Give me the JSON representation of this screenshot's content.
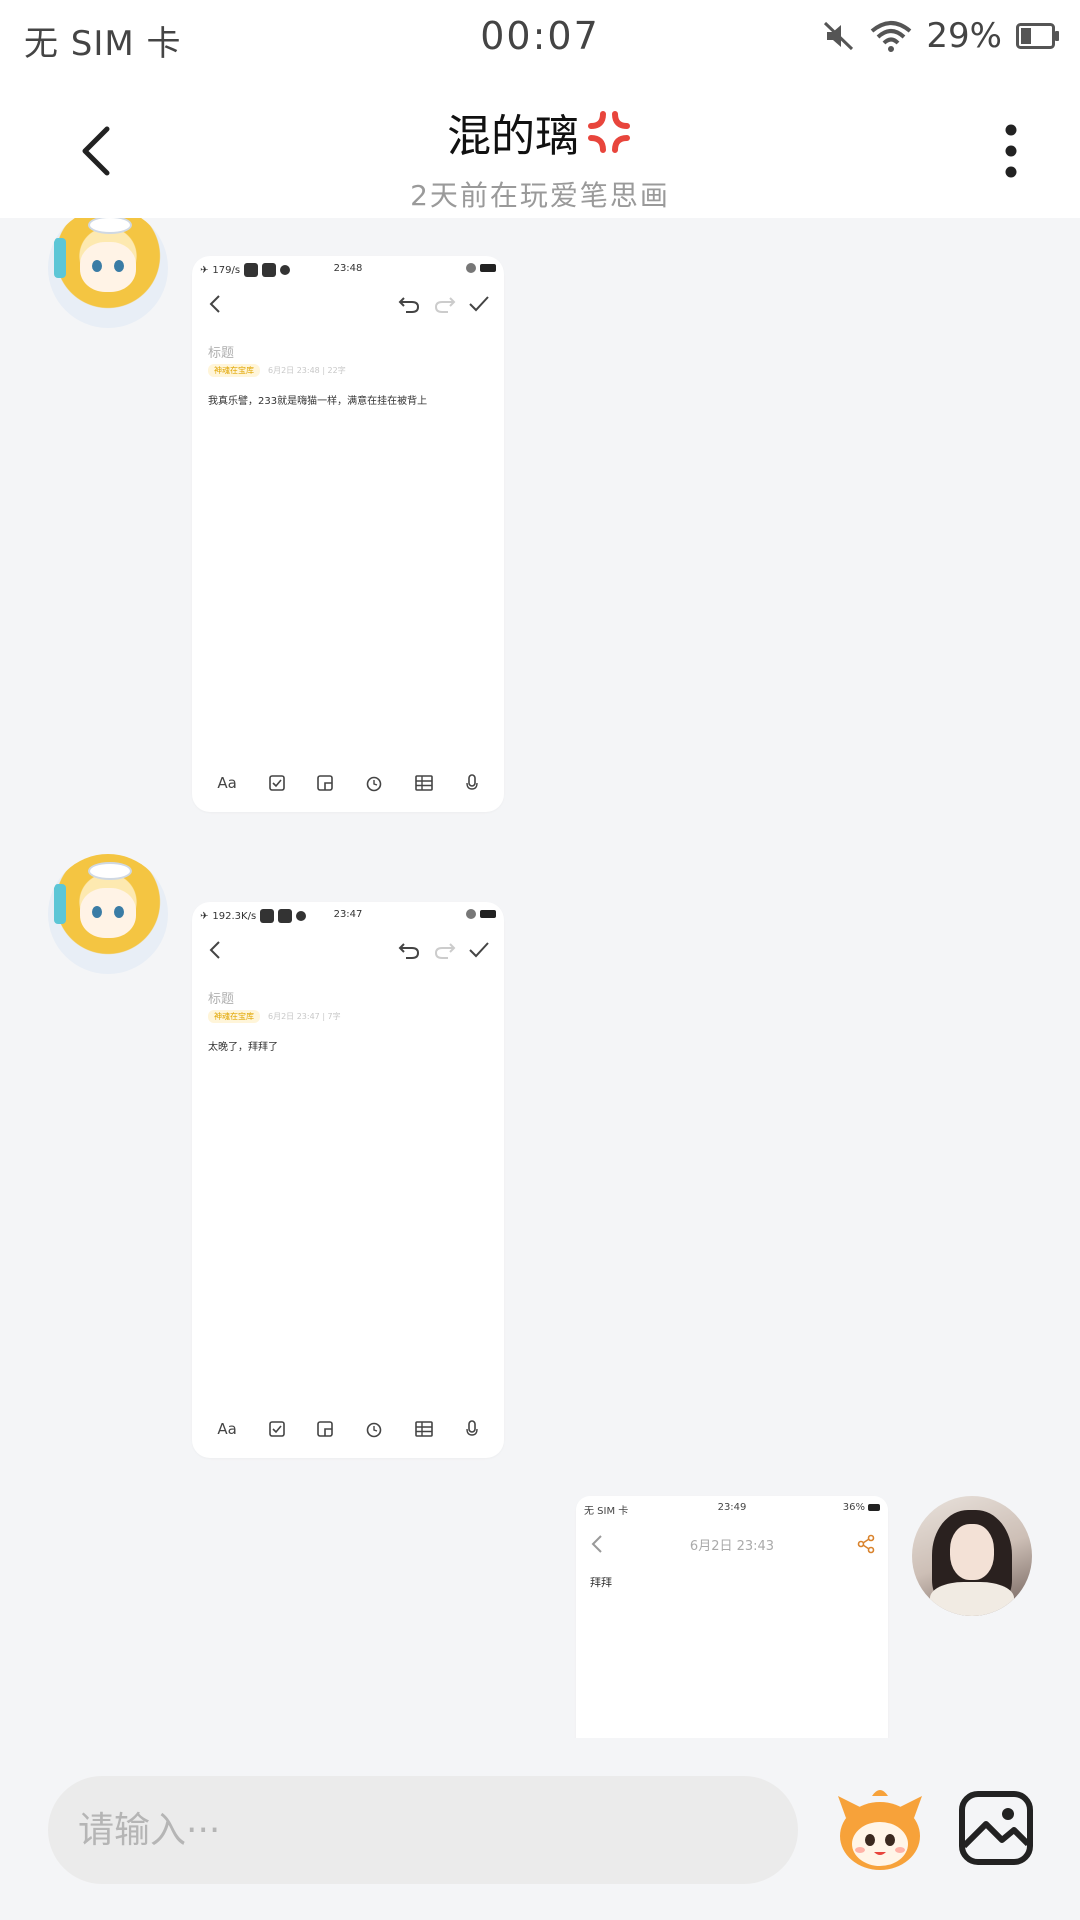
{
  "status_bar": {
    "carrier": "无 SIM 卡",
    "time": "00:07",
    "battery": "29%",
    "icons": [
      "mute-icon",
      "wifi-icon",
      "battery-icon"
    ]
  },
  "header": {
    "title": "混的璃",
    "title_emoji": "anger-symbol-icon",
    "subtitle": "2天前在玩爱笔思画"
  },
  "messages": [
    {
      "sender": "other",
      "type": "screenshot",
      "screenshot": {
        "status_left": "179/s",
        "status_time": "23:48",
        "title_placeholder": "标题",
        "tag": "神魂在宝库",
        "meta": "6月2日 23:48 | 22字",
        "body": "我真乐譬，233就是嗨猫一样，满意在挂在被背上",
        "toolbar": [
          "Aa",
          "checkbox-icon",
          "sticker-icon",
          "alarm-icon",
          "table-icon",
          "mic-icon"
        ]
      }
    },
    {
      "sender": "other",
      "type": "screenshot",
      "screenshot": {
        "status_left": "192.3K/s",
        "status_time": "23:47",
        "title_placeholder": "标题",
        "tag": "神魂在宝库",
        "meta": "6月2日 23:47 | 7字",
        "body": "太晚了，拜拜了",
        "toolbar": [
          "Aa",
          "checkbox-icon",
          "sticker-icon",
          "alarm-icon",
          "table-icon",
          "mic-icon"
        ]
      }
    },
    {
      "sender": "self",
      "type": "screenshot",
      "screenshot": {
        "status_left": "无 SIM 卡",
        "status_time": "23:49",
        "status_right": "36%",
        "date": "6月2日 23:43",
        "body": "拜拜"
      }
    }
  ],
  "input": {
    "placeholder": "请输入···"
  },
  "colors": {
    "chat_background": "#f4f5f7",
    "anger_red": "#e8453c",
    "mascot_orange": "#f7a23a"
  }
}
